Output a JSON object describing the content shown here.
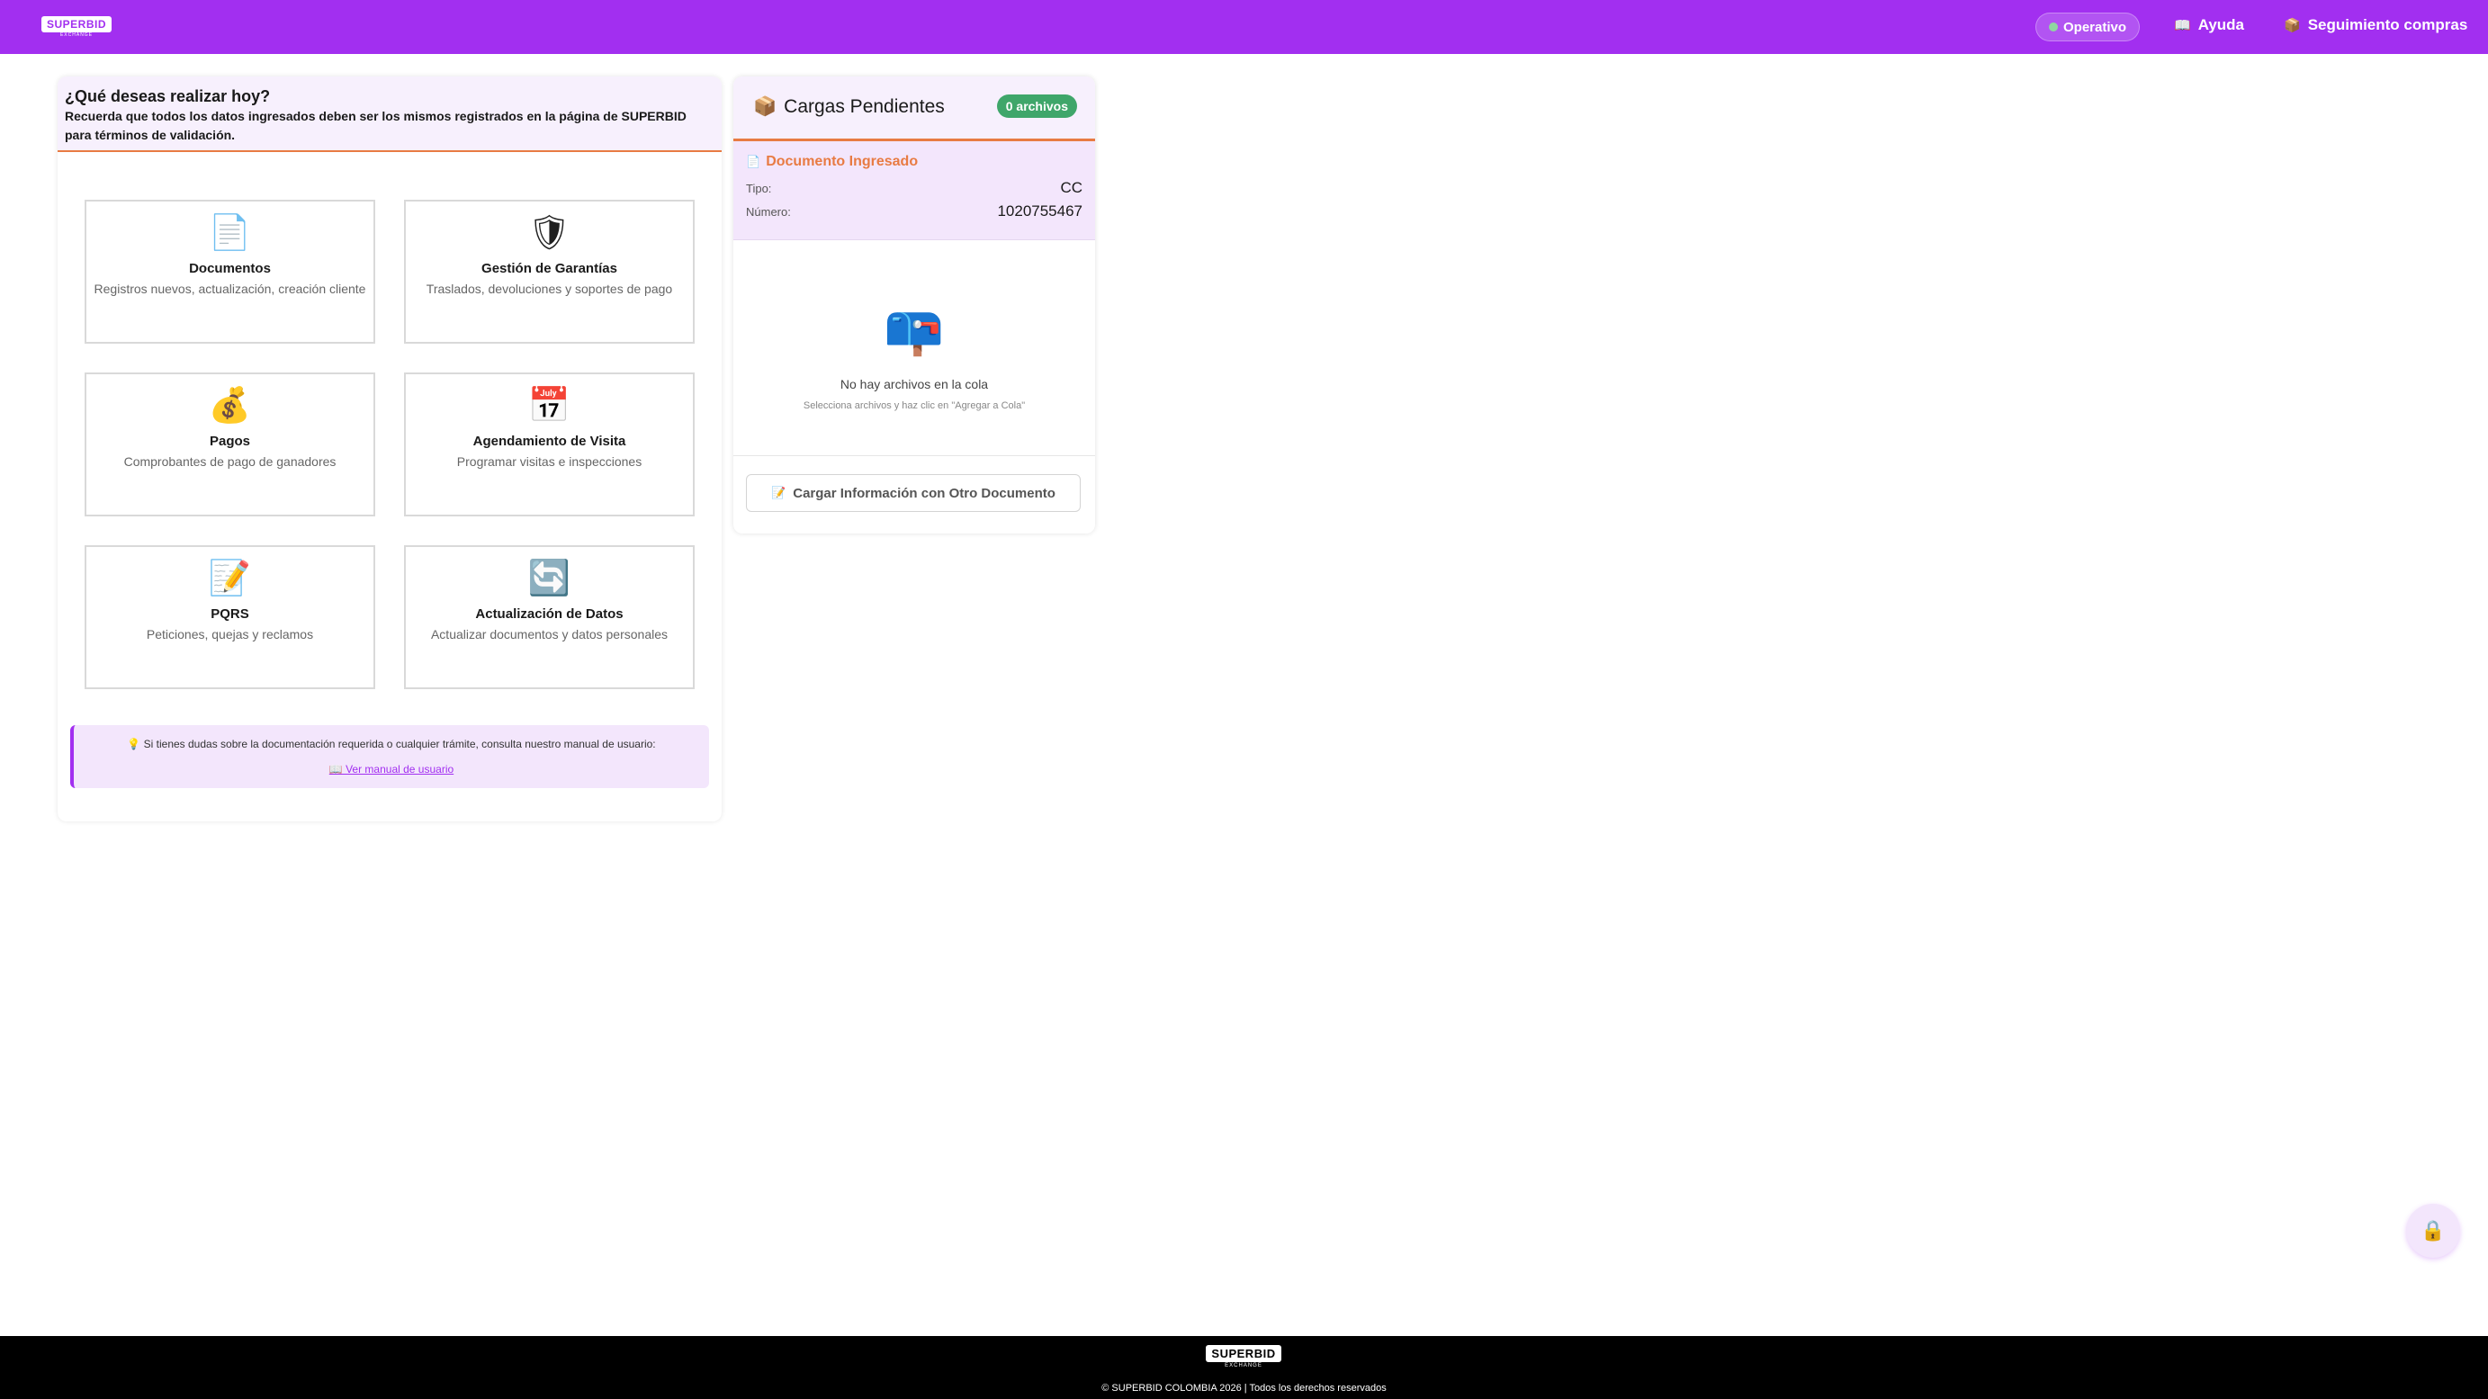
{
  "header": {
    "logo_text": "SUPERBID",
    "logo_sub": "EXCHANGE",
    "status": "Operativo",
    "help": "Ayuda",
    "tracking": "Seguimiento compras",
    "help_icon": "book-icon",
    "tracking_icon": "package-icon"
  },
  "main": {
    "title": "¿Qué deseas realizar hoy?",
    "subtitle": "Recuerda que todos los datos ingresados deben ser los mismos registrados en la página de SUPERBID para términos de validación.",
    "tiles": [
      {
        "icon": "document-icon",
        "glyph": "📄",
        "title": "Documentos",
        "desc": "Registros nuevos, actualización, creación cliente"
      },
      {
        "icon": "shield-icon",
        "glyph": "🛡",
        "title": "Gestión de Garantías",
        "desc": "Traslados, devoluciones y soportes de pago"
      },
      {
        "icon": "money-bag-icon",
        "glyph": "💰",
        "title": "Pagos",
        "desc": "Comprobantes de pago de ganadores"
      },
      {
        "icon": "calendar-icon",
        "glyph": "📅",
        "title": "Agendamiento de Visita",
        "desc": "Programar visitas e inspecciones"
      },
      {
        "icon": "memo-icon",
        "glyph": "📝",
        "title": "PQRS",
        "desc": "Peticiones, quejas y reclamos"
      },
      {
        "icon": "refresh-icon",
        "glyph": "🔄",
        "title": "Actualización de Datos",
        "desc": "Actualizar documentos y datos personales"
      }
    ],
    "help_text": "💡 Si tienes dudas sobre la documentación requerida o cualquier trámite, consulta nuestro manual de usuario:",
    "help_link": "📖 Ver manual de usuario"
  },
  "side": {
    "title": "Cargas Pendientes",
    "count": "0 archivos",
    "doc_label": "Documento Ingresado",
    "tipo_label": "Tipo:",
    "tipo_value": "CC",
    "numero_label": "Número:",
    "numero_value": "1020755467",
    "empty_title": "No hay archivos en la cola",
    "empty_hint": "Selecciona archivos y haz clic en \"Agregar a Cola\"",
    "load_button": "Cargar Información con Otro Documento"
  },
  "footer": {
    "logo_text": "SUPERBID",
    "logo_sub": "EXCHANGE",
    "copyright": "© SUPERBID COLOMBIA 2026 | Todos los derechos reservados"
  }
}
